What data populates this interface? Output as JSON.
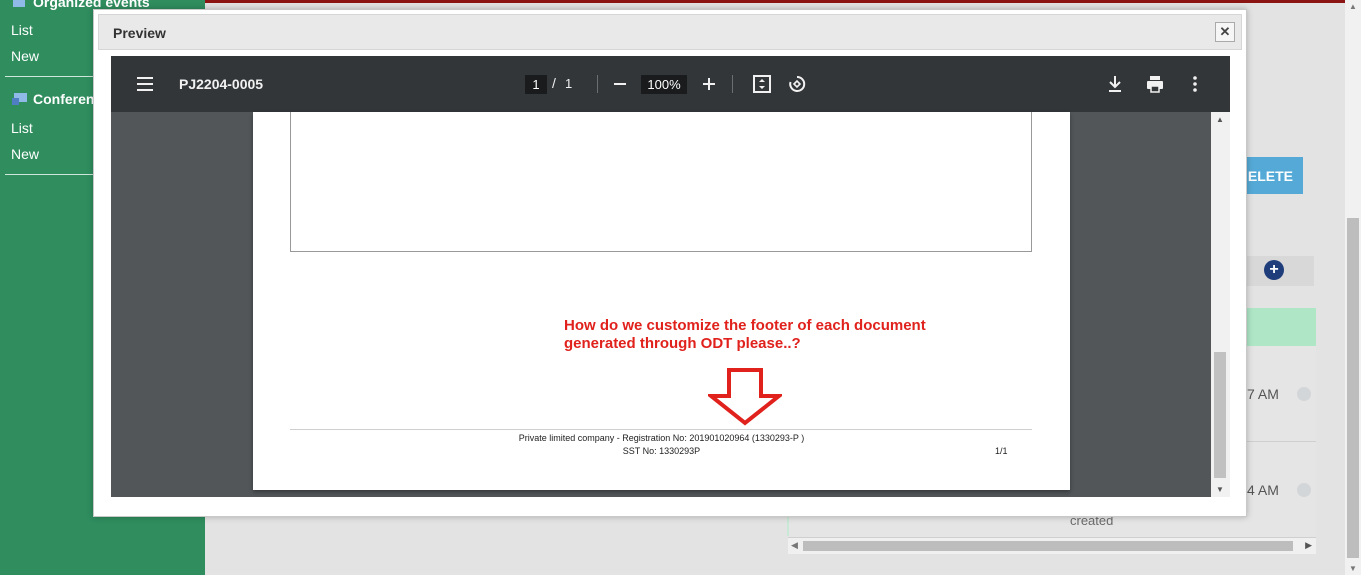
{
  "sidebar": {
    "organized_events": {
      "title": "Organized events",
      "list": "List",
      "new": "New"
    },
    "conferences": {
      "title": "Conferen",
      "list": "List",
      "new": "New"
    }
  },
  "background": {
    "delete_label": "ELETE",
    "add_icon": "+",
    "event_time_1": "7 AM",
    "event_time_2": "4 AM",
    "created_text": "created"
  },
  "modal": {
    "title": "Preview",
    "close_label": "✕",
    "viewer": {
      "doc_title": "PJ2204-0005",
      "page_current": "1",
      "page_sep": "/",
      "page_total": "1",
      "zoom": "100%",
      "annotation": "How do we customize the footer of each document generated through ODT please..?",
      "footer_line1": "Private limited company - Registration No: 201901020964 (1330293-P )",
      "footer_line2": "SST No: 1330293P",
      "footer_page": "1/1"
    }
  },
  "colors": {
    "sidebar_green": "#2f8d5e",
    "toolbar_dark": "#323639",
    "annotation_red": "#e0211c",
    "delete_blue": "#55a9d6"
  },
  "icons": [
    "menu-icon",
    "minus-icon",
    "plus-icon",
    "fit-page-icon",
    "rotate-icon",
    "download-icon",
    "print-icon",
    "more-vert-icon",
    "close-icon",
    "calendar-icon",
    "conference-icon"
  ]
}
